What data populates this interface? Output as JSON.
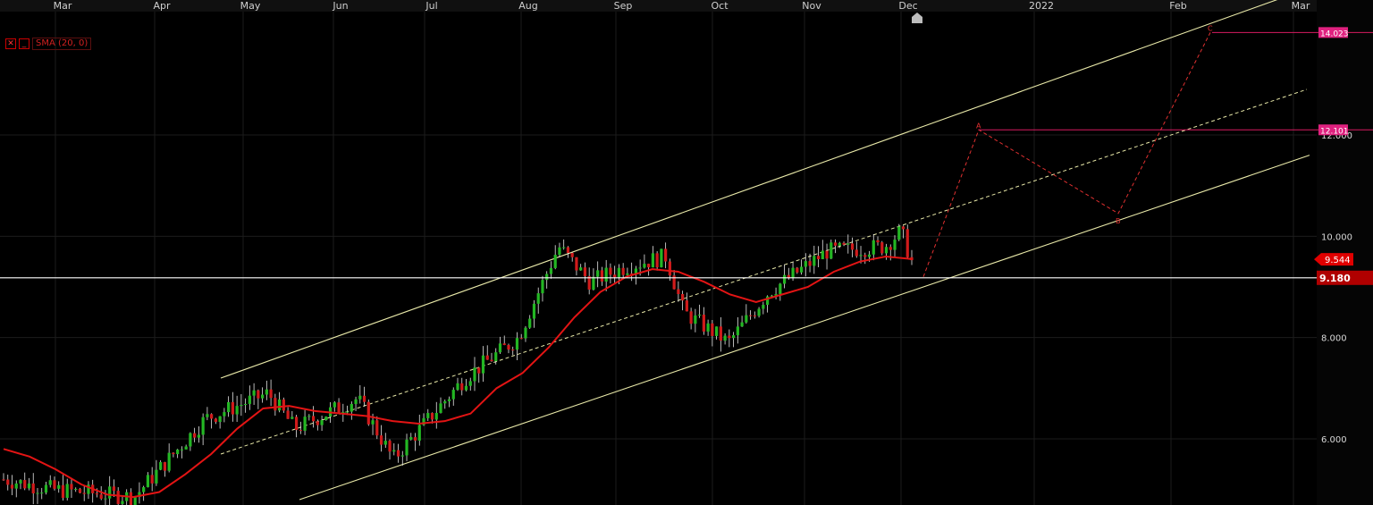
{
  "indicator_legend": {
    "close_symbol": "✕",
    "minimize_symbol": "_",
    "label": "SMA (20, 0)"
  },
  "chart_data": {
    "type": "candlestick",
    "x_axis_labels": [
      "Mar",
      "Apr",
      "May",
      "Jun",
      "Jul",
      "Aug",
      "Sep",
      "Oct",
      "Nov",
      "Dec",
      "2022",
      "Feb",
      "Mar"
    ],
    "y_tick_labels": [
      "6.000",
      "8.000",
      "10.000",
      "12.000"
    ],
    "y_range": [
      4.8,
      14.8
    ],
    "grid": true,
    "colors": {
      "up_candle": "#23b723",
      "down_candle": "#d11b1b",
      "sma_line": "#e31414",
      "channel": "#e8e8a8",
      "projection": "#e03030",
      "target_line": "#d81b60",
      "support_line": "#ffffff"
    },
    "markers": {
      "last_price": "9.544",
      "horizontal_level": "9.180",
      "target_1": "12.101",
      "target_2": "14.023"
    },
    "projection_labels": [
      "A",
      "B",
      "C"
    ],
    "sma_series": {
      "name": "SMA (20, 0)",
      "values": [
        5.8,
        5.65,
        5.4,
        5.1,
        4.9,
        4.85,
        4.95,
        5.3,
        5.7,
        6.2,
        6.6,
        6.65,
        6.55,
        6.5,
        6.45,
        6.35,
        6.3,
        6.35,
        6.5,
        7.0,
        7.3,
        7.8,
        8.4,
        8.9,
        9.2,
        9.35,
        9.3,
        9.1,
        8.85,
        8.7,
        8.85,
        9.0,
        9.3,
        9.5,
        9.6,
        9.55
      ]
    },
    "channel": {
      "upper_start": 7.2,
      "upper_end": 14.8,
      "middle_start": 5.7,
      "middle_end": 12.9,
      "lower_start": 4.8,
      "lower_end": 11.6
    },
    "projection_path": [
      9.2,
      12.101,
      10.45,
      14.023
    ]
  }
}
